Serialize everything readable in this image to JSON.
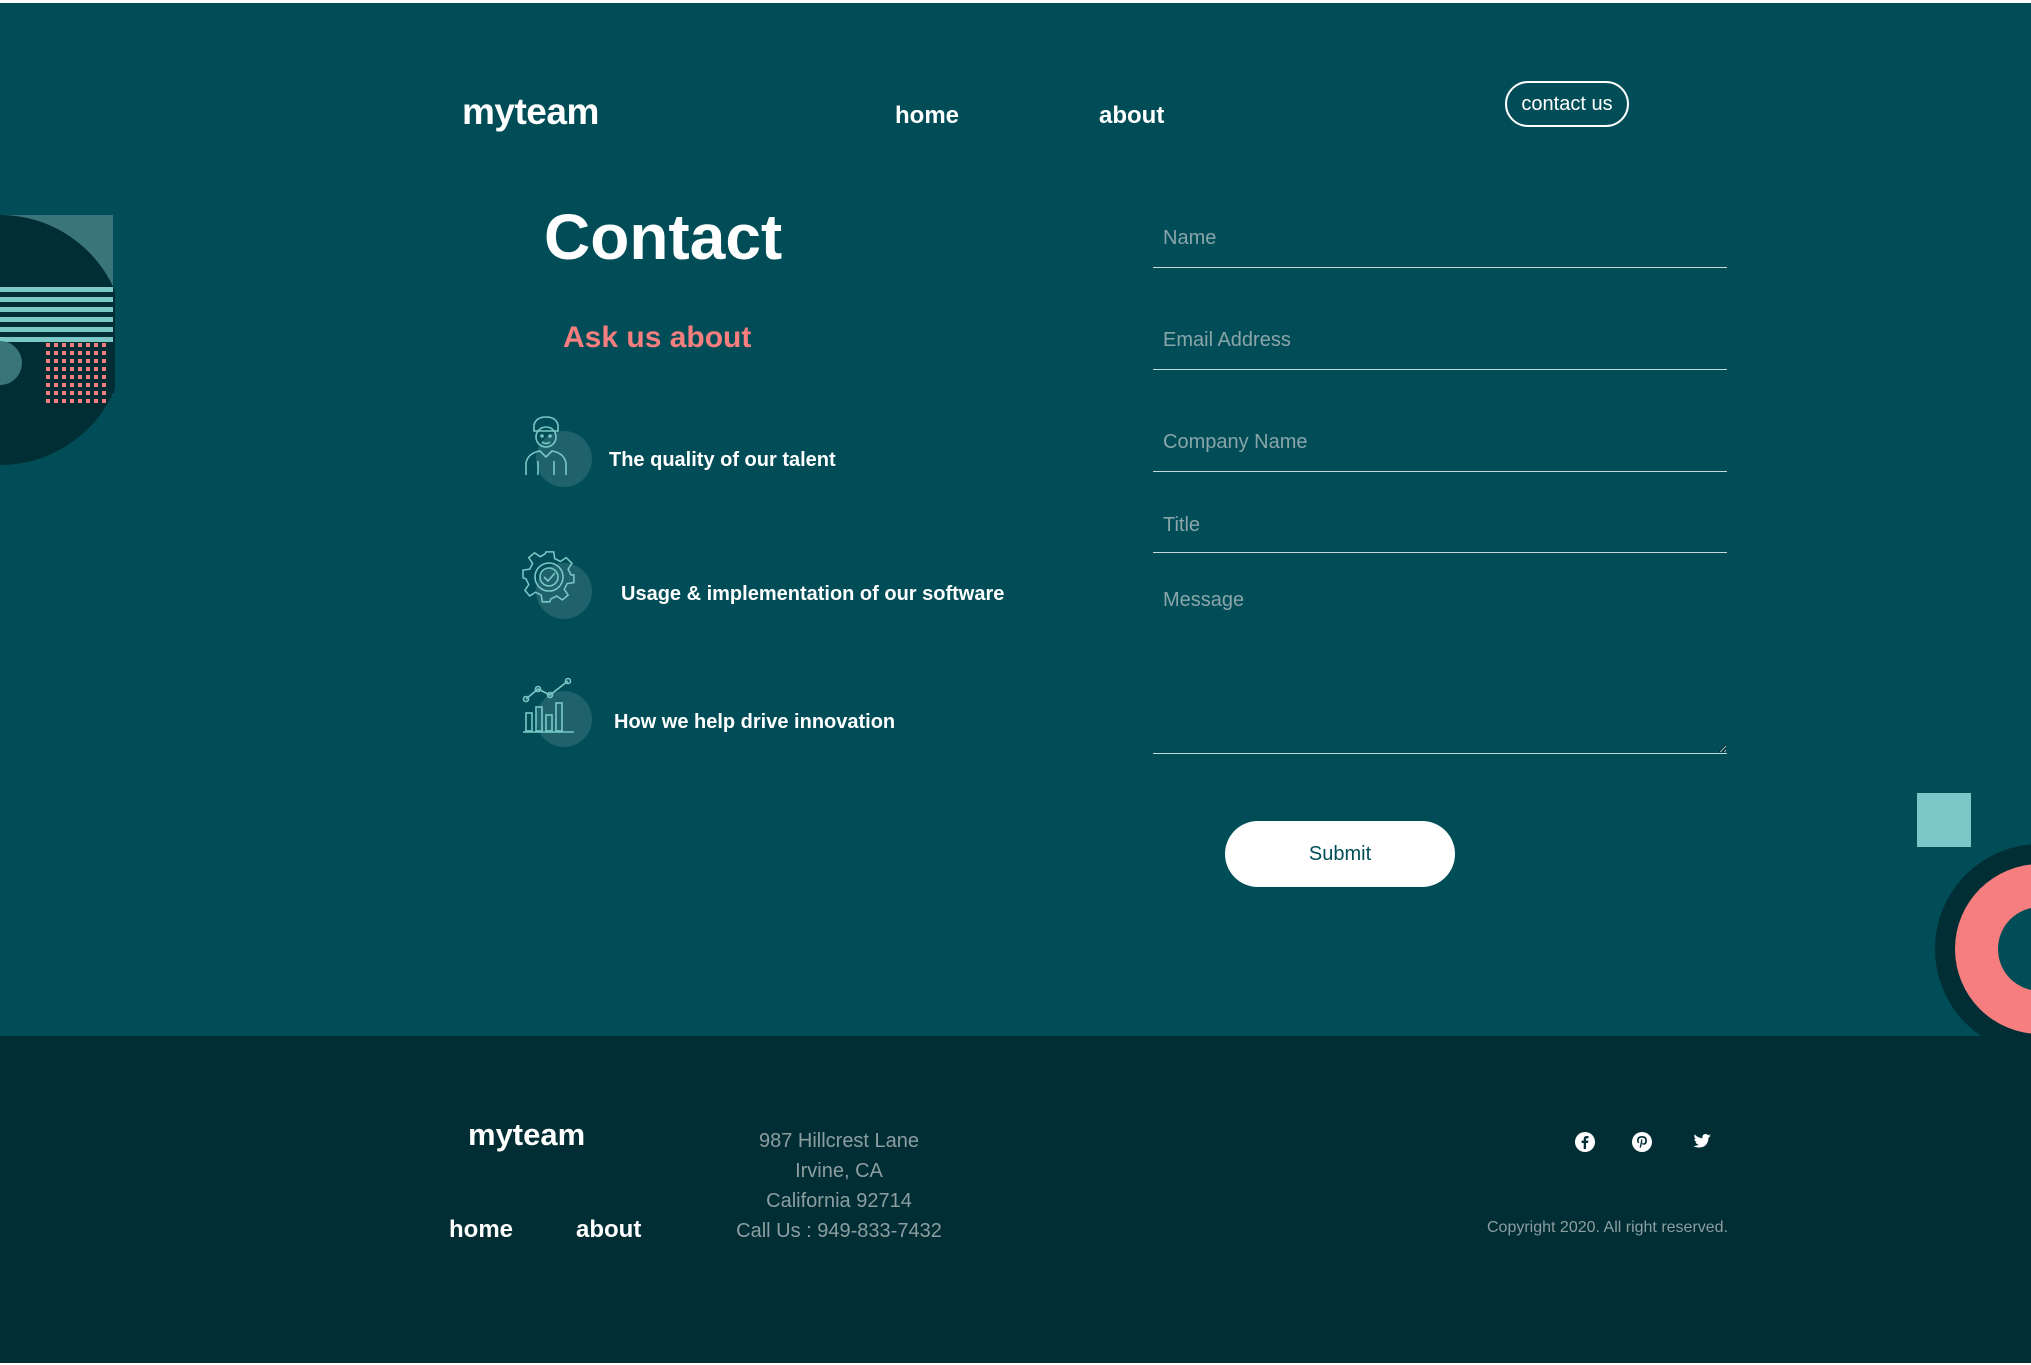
{
  "header": {
    "logo": "myteam",
    "nav": [
      "home",
      "about"
    ],
    "contact_button": "contact us"
  },
  "contact": {
    "title": "Contact",
    "subtitle": "Ask us about",
    "topics": [
      {
        "label": "The quality of our talent",
        "icon": "person-icon"
      },
      {
        "label": "Usage & implementation of our software",
        "icon": "gear-check-icon"
      },
      {
        "label": "How we help drive innovation",
        "icon": "chart-growth-icon"
      }
    ]
  },
  "form": {
    "name_placeholder": "Name",
    "email_placeholder": "Email Address",
    "company_placeholder": "Company Name",
    "title_placeholder": "Title",
    "message_placeholder": "Message",
    "submit": "Submit"
  },
  "footer": {
    "logo": "myteam",
    "nav": [
      "home",
      "about"
    ],
    "address": [
      "987 Hillcrest Lane",
      "Irvine, CA",
      "California 92714",
      "Call Us : 949-833-7432"
    ],
    "social": [
      "facebook-icon",
      "pinterest-icon",
      "twitter-icon"
    ],
    "copyright": "Copyright 2020. All right reserved."
  },
  "colors": {
    "background": "#004d57",
    "footer_background": "#012e34",
    "accent_coral": "#f67e7e",
    "accent_teal": "#79c8c7"
  }
}
